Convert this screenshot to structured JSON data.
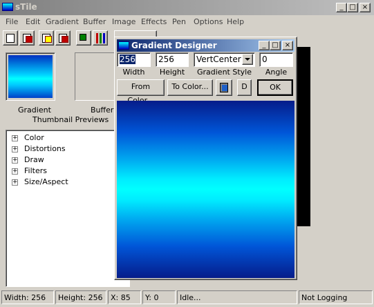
{
  "app": {
    "title": "sTile",
    "controls": {
      "minimize": "_",
      "maximize": "□",
      "close": "×"
    }
  },
  "menu": [
    "File",
    "Edit",
    "Gradient",
    "Buffer",
    "Image",
    "Effects",
    "Pen",
    "Options",
    "Help"
  ],
  "thumbnails": {
    "gradient_label": "Gradient",
    "buffer_label": "Buffer",
    "group_label": "Thumbnail Previews"
  },
  "tree": {
    "items": [
      "Color",
      "Distortions",
      "Draw",
      "Filters",
      "Size/Aspect"
    ],
    "expander": "+"
  },
  "status": {
    "width": "Width: 256",
    "height": "Height: 256",
    "x": "X: 85",
    "y": "Y: 0",
    "state": "Idle...",
    "logging": "Not Logging"
  },
  "dialog": {
    "title": "Gradient Designer",
    "width_value": "256",
    "height_value": "256",
    "style_value": "VertCenter",
    "angle_value": "0",
    "width_label": "Width",
    "height_label": "Height",
    "style_label": "Gradient Style",
    "angle_label": "Angle",
    "from_color": "From Color...",
    "to_color": "To Color...",
    "d_button": "D",
    "ok_button": "OK",
    "controls": {
      "minimize": "_",
      "maximize": "□",
      "close": "×"
    }
  },
  "colors": {
    "gradient_from": "#061c8a",
    "gradient_to": "#00ffff",
    "dialog_title_active": "#0a246a",
    "window_title_inactive": "#808080"
  }
}
